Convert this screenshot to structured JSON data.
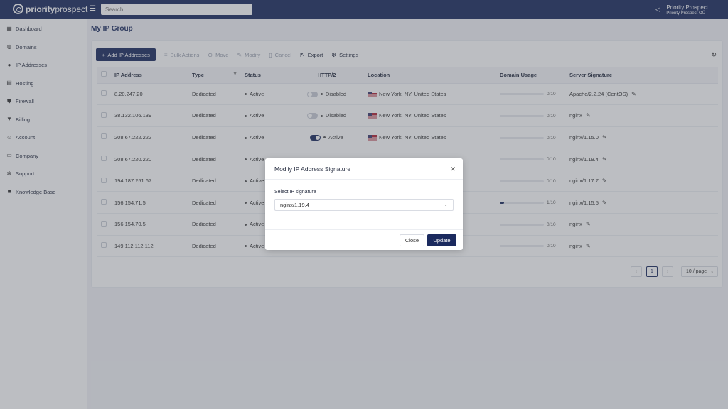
{
  "brand": {
    "name_bold": "priority",
    "name_light": "prospect"
  },
  "search": {
    "placeholder": "Search..."
  },
  "user": {
    "name": "Priority Prospect",
    "org": "Priority Prospect OÜ"
  },
  "sidebar": {
    "items": [
      {
        "label": "Dashboard",
        "icon": "dashboard-icon",
        "glyph": "▦"
      },
      {
        "label": "Domains",
        "icon": "globe-icon",
        "glyph": "◍"
      },
      {
        "label": "IP Addresses",
        "icon": "location-pin-icon",
        "glyph": "●"
      },
      {
        "label": "Hosting",
        "icon": "server-icon",
        "glyph": "▤"
      },
      {
        "label": "Firewall",
        "icon": "shield-icon",
        "glyph": "⛊"
      },
      {
        "label": "Billing",
        "icon": "cart-icon",
        "glyph": "▼"
      },
      {
        "label": "Account",
        "icon": "user-icon",
        "glyph": "☺"
      },
      {
        "label": "Company",
        "icon": "document-icon",
        "glyph": "▭"
      },
      {
        "label": "Support",
        "icon": "gear-icon",
        "glyph": "✻"
      },
      {
        "label": "Knowledge Base",
        "icon": "book-icon",
        "glyph": "■"
      }
    ]
  },
  "page": {
    "title": "My IP Group"
  },
  "toolbar": {
    "add_label": "Add IP Addresses",
    "bulk_label": "Bulk Actions",
    "move_label": "Move",
    "modify_label": "Modify",
    "cancel_label": "Cancel",
    "export_label": "Export",
    "settings_label": "Settings"
  },
  "table": {
    "headers": {
      "ip": "IP Address",
      "type": "Type",
      "status": "Status",
      "http2": "HTTP/2",
      "location": "Location",
      "usage": "Domain Usage",
      "signature": "Server Signature"
    },
    "rows": [
      {
        "ip": "8.20.247.20",
        "type": "Dedicated",
        "status": "Active",
        "http2_on": false,
        "http2": "Disabled",
        "location": "New York, NY, United States",
        "usage_fraction": 0,
        "usage": "0/10",
        "signature": "Apache/2.2.24 (CentOS)"
      },
      {
        "ip": "38.132.106.139",
        "type": "Dedicated",
        "status": "Active",
        "http2_on": false,
        "http2": "Disabled",
        "location": "New York, NY, United States",
        "usage_fraction": 0,
        "usage": "0/10",
        "signature": "nginx"
      },
      {
        "ip": "208.67.222.222",
        "type": "Dedicated",
        "status": "Active",
        "http2_on": true,
        "http2": "Active",
        "location": "New York, NY, United States",
        "usage_fraction": 0,
        "usage": "0/10",
        "signature": "nginx/1.15.0"
      },
      {
        "ip": "208.67.220.220",
        "type": "Dedicated",
        "status": "Active",
        "http2_on": false,
        "http2": "",
        "location": "",
        "usage_fraction": 0,
        "usage": "0/10",
        "signature": "nginx/1.19.4"
      },
      {
        "ip": "194.187.251.67",
        "type": "Dedicated",
        "status": "Active",
        "http2_on": false,
        "http2": "",
        "location": "",
        "usage_fraction": 0,
        "usage": "0/10",
        "signature": "nginx/1.17.7"
      },
      {
        "ip": "156.154.71.5",
        "type": "Dedicated",
        "status": "Active",
        "http2_on": false,
        "http2": "",
        "location": "",
        "usage_fraction": 0.1,
        "usage": "1/10",
        "signature": "nginx/1.15.5"
      },
      {
        "ip": "156.154.70.5",
        "type": "Dedicated",
        "status": "Active",
        "http2_on": false,
        "http2": "",
        "location": "",
        "usage_fraction": 0,
        "usage": "0/10",
        "signature": "nginx"
      },
      {
        "ip": "149.112.112.112",
        "type": "Dedicated",
        "status": "Active",
        "http2_on": false,
        "http2": "",
        "location": "",
        "usage_fraction": 0,
        "usage": "0/10",
        "signature": "nginx"
      }
    ]
  },
  "pagination": {
    "current": "1",
    "page_size": "10 / page"
  },
  "modal": {
    "title": "Modify IP Address Signature",
    "field_label": "Select IP signature",
    "selected_value": "nginx/1.19.4",
    "close_label": "Close",
    "update_label": "Update"
  },
  "colors": {
    "brand": "#1b2a5e",
    "overlay": "#50545f"
  }
}
